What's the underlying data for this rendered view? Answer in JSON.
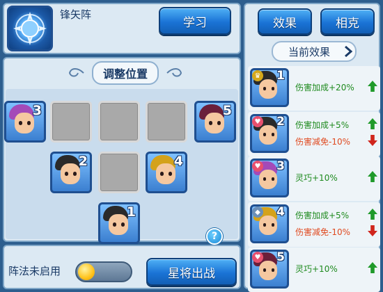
{
  "formation": {
    "name": "锋矢阵",
    "learn_label": "学习",
    "adjust_title": "调整位置",
    "status_label": "阵法未启用",
    "deploy_label": "星将出战",
    "help_glyph": "?",
    "slots": [
      {
        "num": "3",
        "hair": "#a44ab8"
      },
      {
        "num": "",
        "hair": ""
      },
      {
        "num": "",
        "hair": ""
      },
      {
        "num": "",
        "hair": ""
      },
      {
        "num": "5",
        "hair": "#6b1f3a"
      },
      {
        "num": "2",
        "hair": "#2a2a2a"
      },
      {
        "num": "",
        "hair": ""
      },
      {
        "num": "4",
        "hair": "#d4a21a"
      },
      {
        "num": "1",
        "hair": "#2a2a2a"
      }
    ]
  },
  "side": {
    "tab_effect": "效果",
    "tab_counter": "相克",
    "current_effect": "当前效果",
    "rows": [
      {
        "num": "1",
        "hair": "#2a2a2a",
        "badge": "crown-icon",
        "badge_color": "#d6a81a",
        "badge_glyph": "♛",
        "effects": [
          {
            "text": "伤害加成+20%",
            "kind": "buff"
          }
        ]
      },
      {
        "num": "2",
        "hair": "#2a2a2a",
        "badge": "heart-icon",
        "badge_color": "#e8506e",
        "badge_glyph": "♥",
        "effects": [
          {
            "text": "伤害加成+5%",
            "kind": "buff"
          },
          {
            "text": "伤害减免-10%",
            "kind": "debuff"
          }
        ]
      },
      {
        "num": "3",
        "hair": "#a44ab8",
        "badge": "heart-icon",
        "badge_color": "#e8506e",
        "badge_glyph": "♥",
        "effects": [
          {
            "text": "灵巧+10%",
            "kind": "buff"
          }
        ]
      },
      {
        "num": "4",
        "hair": "#d4a21a",
        "badge": "shield-icon",
        "badge_color": "#6b8fb8",
        "badge_glyph": "◆",
        "effects": [
          {
            "text": "伤害加成+5%",
            "kind": "buff"
          },
          {
            "text": "伤害减免-10%",
            "kind": "debuff"
          }
        ]
      },
      {
        "num": "5",
        "hair": "#6b1f3a",
        "badge": "heart-icon",
        "badge_color": "#e8506e",
        "badge_glyph": "♥",
        "effects": [
          {
            "text": "灵巧+10%",
            "kind": "buff"
          }
        ]
      }
    ]
  }
}
